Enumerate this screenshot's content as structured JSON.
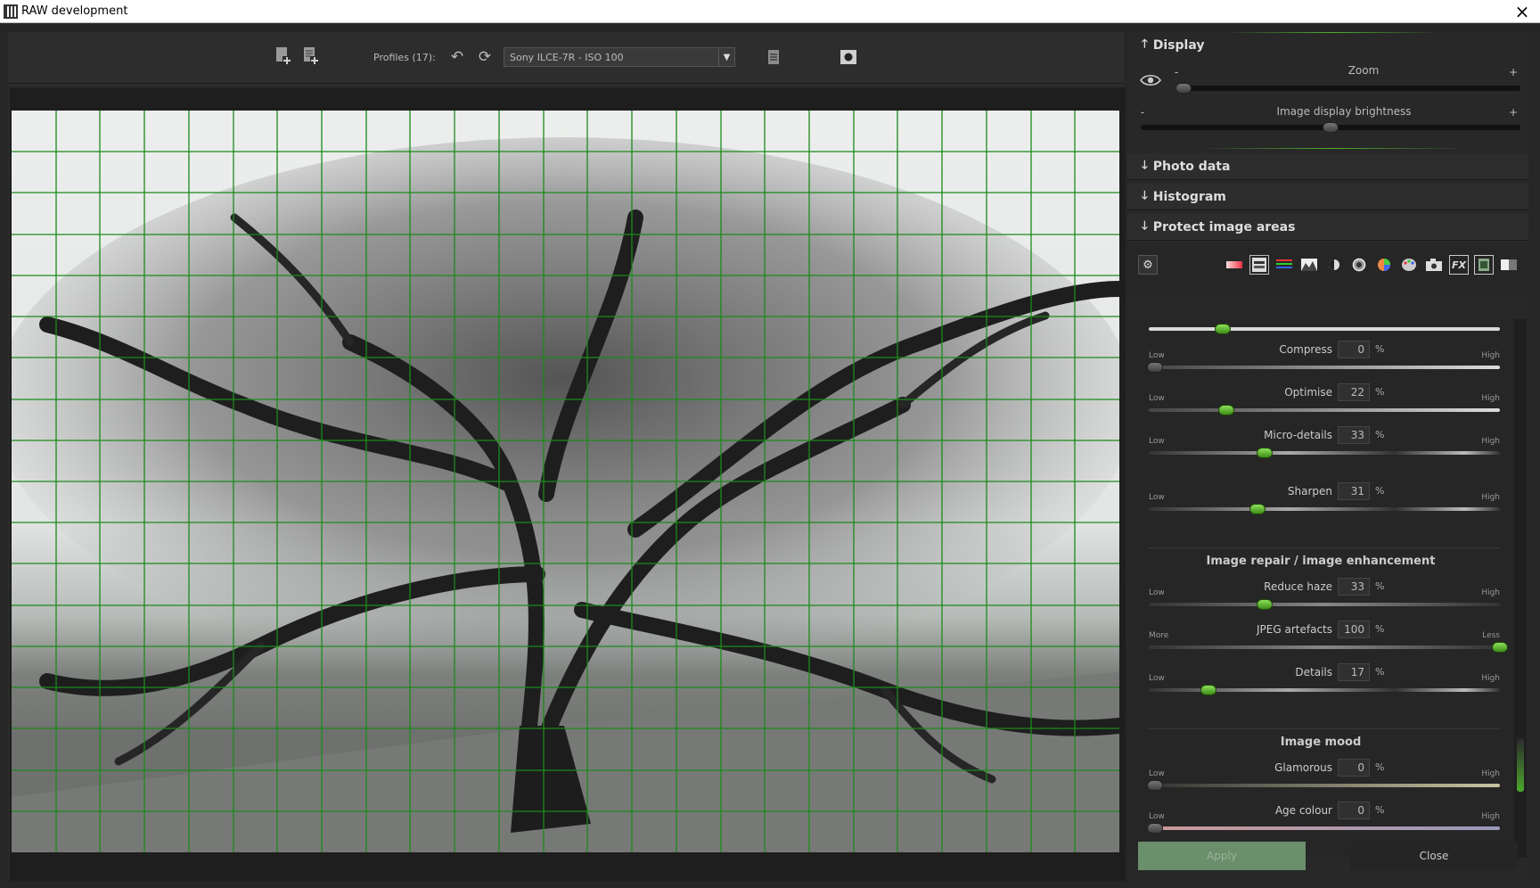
{
  "window": {
    "title": "RAW development",
    "close_icon": "×"
  },
  "toolbar": {
    "add_profile_icon": "add-profile-icon",
    "save_profile_icon": "save-profile-icon",
    "profiles_label": "Profiles (17):",
    "undo_icon": "↶",
    "redo_icon": "⟳",
    "profile_value": "Sony ILCE-7R - ISO 100",
    "dropdown_arrow": "▼",
    "delete_profile_icon": "delete-icon",
    "camera_icon": "camera-icon"
  },
  "right": {
    "display": {
      "title": "Display",
      "zoom_label": "Zoom",
      "zoom_minus": "-",
      "zoom_plus": "+",
      "brightness_label": "Image display brightness",
      "brightness_minus": "-",
      "brightness_plus": "+",
      "zoom_level": 0.02,
      "brightness_level": 0.5
    },
    "sections": [
      {
        "title": "Photo data"
      },
      {
        "title": "Histogram"
      },
      {
        "title": "Protect image areas"
      }
    ],
    "tabs": [
      "settings-gear-icon",
      "gradient-icon",
      "sharpen-tab-icon",
      "color-bars-icon",
      "landscape-icon",
      "contrast-icon",
      "tone-icon",
      "color-wheel-icon",
      "palette-icon",
      "camera-tab-icon",
      "fx-icon",
      "film-icon",
      "bw-icon"
    ],
    "fx_label": "FX",
    "sliders": {
      "low": "Low",
      "high": "High",
      "percent": "%",
      "items": [
        {
          "name": "Compress",
          "value": "0"
        },
        {
          "name": "Optimise",
          "value": "22"
        },
        {
          "name": "Micro-details",
          "value": "33"
        },
        {
          "name": "Sharpen",
          "value": "31"
        }
      ],
      "repair_title": "Image repair / image enhancement",
      "repair_items": [
        {
          "name": "Reduce haze",
          "value": "33",
          "low": "Low",
          "high": "High"
        },
        {
          "name": "JPEG artefacts",
          "value": "100",
          "low": "More",
          "high": "Less"
        },
        {
          "name": "Details",
          "value": "17",
          "low": "Low",
          "high": "High"
        }
      ],
      "mood_title": "Image mood",
      "mood_items": [
        {
          "name": "Glamorous",
          "value": "0"
        },
        {
          "name": "Age colour",
          "value": "0"
        }
      ]
    },
    "apply_label": "Apply",
    "close_label": "Close"
  },
  "colors": {
    "accent": "#4caf2e",
    "grid": "#1b8a1b"
  }
}
